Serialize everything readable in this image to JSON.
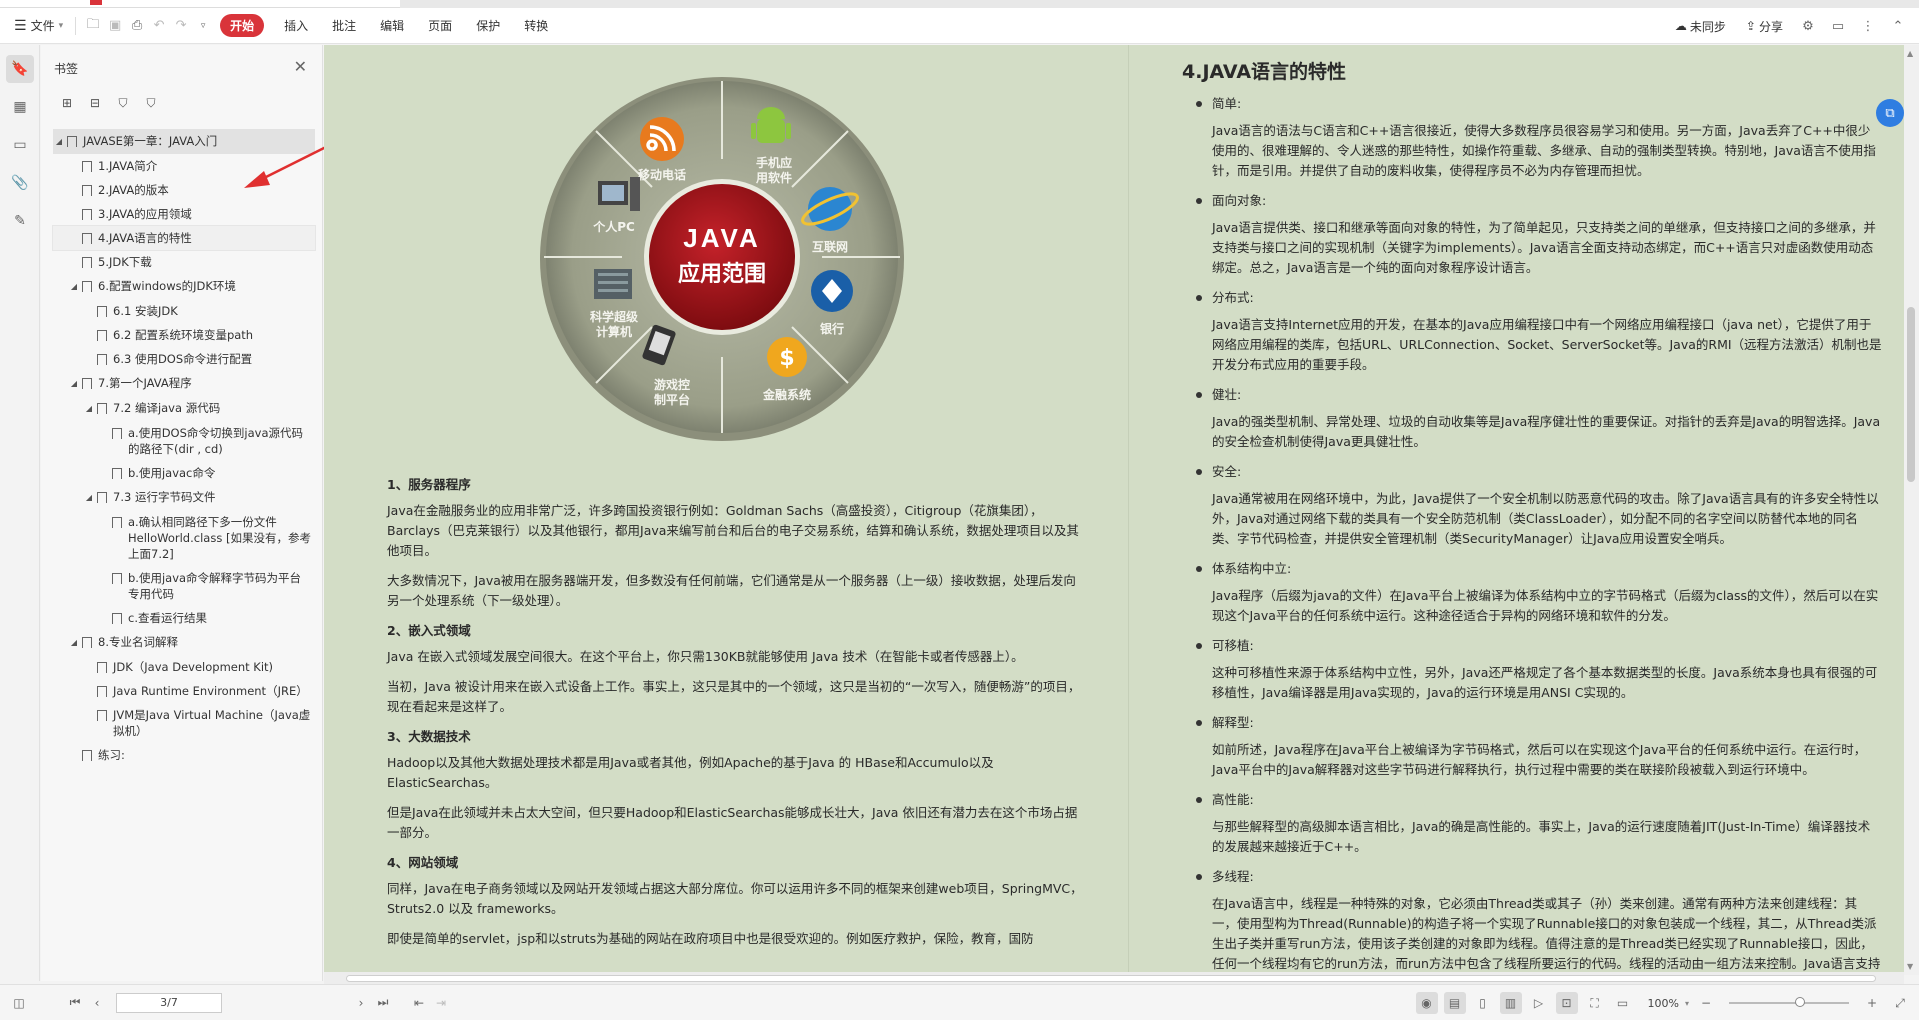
{
  "toolbar": {
    "file_label": "文件",
    "menus": [
      "开始",
      "插入",
      "批注",
      "编辑",
      "页面",
      "保护",
      "转换"
    ],
    "sync_label": "未同步",
    "share_label": "分享"
  },
  "panel": {
    "title": "书签",
    "items": [
      {
        "label": "JAVASE第一章：JAVA入门",
        "level": 0,
        "toggle": "◢"
      },
      {
        "label": "1.JAVA简介",
        "level": 1,
        "toggle": ""
      },
      {
        "label": "2.JAVA的版本",
        "level": 1,
        "toggle": ""
      },
      {
        "label": "3.JAVA的应用领域",
        "level": 1,
        "toggle": ""
      },
      {
        "label": "4.JAVA语言的特性",
        "level": 1,
        "toggle": ""
      },
      {
        "label": "5.JDK下载",
        "level": 1,
        "toggle": ""
      },
      {
        "label": "6.配置windows的JDK环境",
        "level": 1,
        "toggle": "◢"
      },
      {
        "label": "6.1 安装JDK",
        "level": 2,
        "toggle": ""
      },
      {
        "label": "6.2 配置系统环境变量path",
        "level": 2,
        "toggle": ""
      },
      {
        "label": "6.3 使用DOS命令进行配置",
        "level": 2,
        "toggle": ""
      },
      {
        "label": "7.第一个JAVA程序",
        "level": 1,
        "toggle": "◢"
      },
      {
        "label": "7.2 编译java 源代码",
        "level": 2,
        "toggle": "◢"
      },
      {
        "label": "a.使用DOS命令切换到java源代码的路径下(dir , cd)",
        "level": 3,
        "toggle": ""
      },
      {
        "label": "b.使用javac命令",
        "level": 3,
        "toggle": ""
      },
      {
        "label": "7.3 运行字节码文件",
        "level": 2,
        "toggle": "◢"
      },
      {
        "label": "a.确认相同路径下多一份文件 HelloWorld.class [如果没有，参考上面7.2]",
        "level": 3,
        "toggle": ""
      },
      {
        "label": "b.使用java命令解释字节码为平台专用代码",
        "level": 3,
        "toggle": ""
      },
      {
        "label": "c.查看运行结果",
        "level": 3,
        "toggle": ""
      },
      {
        "label": "8.专业名词解释",
        "level": 1,
        "toggle": "◢"
      },
      {
        "label": "JDK（Java Development Kit)",
        "level": 2,
        "toggle": ""
      },
      {
        "label": "Java Runtime Environment（JRE）",
        "level": 2,
        "toggle": ""
      },
      {
        "label": "JVM是Java Virtual Machine（Java虚拟机）",
        "level": 2,
        "toggle": ""
      },
      {
        "label": "练习:",
        "level": 1,
        "toggle": ""
      }
    ]
  },
  "wheel": {
    "center_line1": "JAVA",
    "center_line2": "应用范围",
    "segments": [
      "移动电话",
      "手机应用软件",
      "互联网",
      "银行",
      "金融系统",
      "游戏控制平台",
      "科学超级计算机",
      "个人PC"
    ]
  },
  "left_column": {
    "blocks": [
      {
        "type": "h",
        "text": "1、服务器程序"
      },
      {
        "type": "p",
        "text": "Java在金融服务业的应用非常广泛，许多跨国投资银行例如：Goldman Sachs（高盛投资），Citigroup（花旗集团），Barclays（巴克莱银行）以及其他银行，都用Java来编写前台和后台的电子交易系统，结算和确认系统，数据处理项目以及其他项目。"
      },
      {
        "type": "p",
        "text": "大多数情况下，Java被用在服务器端开发，但多数没有任何前端，它们通常是从一个服务器（上一级）接收数据，处理后发向另一个处理系统（下一级处理）。"
      },
      {
        "type": "h",
        "text": "2、嵌入式领域"
      },
      {
        "type": "p",
        "text": "Java 在嵌入式领域发展空间很大。在这个平台上，你只需130KB就能够使用 Java 技术（在智能卡或者传感器上）。"
      },
      {
        "type": "p",
        "text": "当初，Java 被设计用来在嵌入式设备上工作。事实上，这只是其中的一个领域，这只是当初的“一次写入，随便畅游”的项目，现在看起来是这样了。"
      },
      {
        "type": "h",
        "text": "3、大数据技术"
      },
      {
        "type": "p",
        "text": "Hadoop以及其他大数据处理技术都是用Java或者其他，例如Apache的基于Java 的 HBase和Accumulo以及 ElasticSearchas。"
      },
      {
        "type": "p",
        "text": "但是Java在此领域并未占太大空间，但只要Hadoop和ElasticSearchas能够成长壮大，Java 依旧还有潜力去在这个市场占据一部分。"
      },
      {
        "type": "h",
        "text": "4、网站领域"
      },
      {
        "type": "p",
        "text": "同样，Java在电子商务领域以及网站开发领域占据这大部分席位。你可以运用许多不同的框架来创建web项目，SpringMVC，Struts2.0 以及 frameworks。"
      },
      {
        "type": "p",
        "text": "即使是简单的servlet，jsp和以struts为基础的网站在政府项目中也是很受欢迎的。例如医疗救护，保险，教育，国防"
      }
    ]
  },
  "right_column": {
    "title": "4.JAVA语言的特性",
    "sections": [
      {
        "head": "简单:",
        "body": "Java语言的语法与C语言和C++语言很接近，使得大多数程序员很容易学习和使用。另一方面，Java丢弃了C++中很少使用的、很难理解的、令人迷惑的那些特性，如操作符重载、多继承、自动的强制类型转换。特别地，Java语言不使用指针，而是引用。并提供了自动的废料收集，使得程序员不必为内存管理而担忧。"
      },
      {
        "head": "面向对象:",
        "body": "Java语言提供类、接口和继承等面向对象的特性，为了简单起见，只支持类之间的单继承，但支持接口之间的多继承，并支持类与接口之间的实现机制（关键字为implements）。Java语言全面支持动态绑定，而C++语言只对虚函数使用动态绑定。总之，Java语言是一个纯的面向对象程序设计语言。"
      },
      {
        "head": "分布式:",
        "body": "Java语言支持Internet应用的开发，在基本的Java应用编程接口中有一个网络应用编程接口（java net），它提供了用于网络应用编程的类库，包括URL、URLConnection、Socket、ServerSocket等。Java的RMI（远程方法激活）机制也是开发分布式应用的重要手段。"
      },
      {
        "head": "健壮:",
        "body": "Java的强类型机制、异常处理、垃圾的自动收集等是Java程序健壮性的重要保证。对指针的丢弃是Java的明智选择。Java的安全检查机制使得Java更具健壮性。"
      },
      {
        "head": "安全:",
        "body": "Java通常被用在网络环境中，为此，Java提供了一个安全机制以防恶意代码的攻击。除了Java语言具有的许多安全特性以外，Java对通过网络下载的类具有一个安全防范机制（类ClassLoader），如分配不同的名字空间以防替代本地的同名类、字节代码检查，并提供安全管理机制（类SecurityManager）让Java应用设置安全哨兵。"
      },
      {
        "head": "体系结构中立:",
        "body": "Java程序（后缀为java的文件）在Java平台上被编译为体系结构中立的字节码格式（后缀为class的文件），然后可以在实现这个Java平台的任何系统中运行。这种途径适合于异构的网络环境和软件的分发。"
      },
      {
        "head": "可移植:",
        "body": "这种可移植性来源于体系结构中立性，另外，Java还严格规定了各个基本数据类型的长度。Java系统本身也具有很强的可移植性，Java编译器是用Java实现的，Java的运行环境是用ANSI C实现的。"
      },
      {
        "head": "解释型:",
        "body": "如前所述，Java程序在Java平台上被编译为字节码格式，然后可以在实现这个Java平台的任何系统中运行。在运行时，Java平台中的Java解释器对这些字节码进行解释执行，执行过程中需要的类在联接阶段被载入到运行环境中。"
      },
      {
        "head": "高性能:",
        "body": "与那些解释型的高级脚本语言相比，Java的确是高性能的。事实上，Java的运行速度随着JIT(Just-In-Time）编译器技术的发展越来越接近于C++。"
      },
      {
        "head": "多线程:",
        "body": "在Java语言中，线程是一种特殊的对象，它必须由Thread类或其子（孙）类来创建。通常有两种方法来创建线程：其一，使用型构为Thread(Runnable)的构造子将一个实现了Runnable接口的对象包装成一个线程，其二，从Thread类派生出子类并重写run方法，使用该子类创建的对象即为线程。值得注意的是Thread类已经实现了Runnable接口，因此，任何一个线程均有它的run方法，而run方法中包含了线程所要运行的代码。线程的活动由一组方法来控制。Java语言支持多个线程的同时执行，并提供多线程之间的同步机制（关键字为"
      }
    ]
  },
  "status": {
    "page_indicator": "3/7",
    "zoom": "100%"
  }
}
